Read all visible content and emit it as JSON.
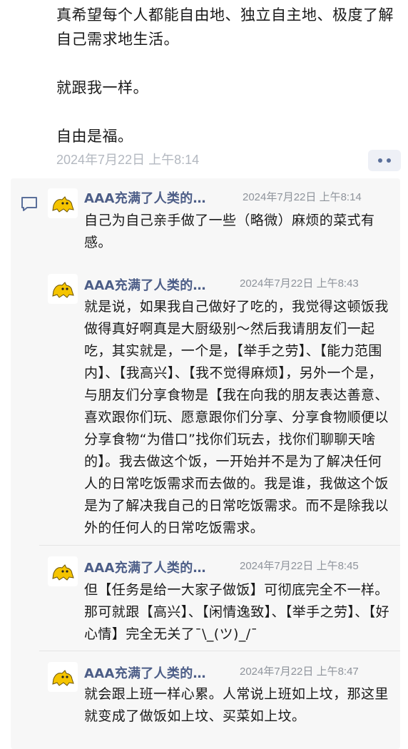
{
  "post": {
    "lines": [
      "真希望每个人都能自由地、独立自主地、极度了解自己需求地生活。",
      "就跟我一样。",
      "自由是福。"
    ],
    "timestamp": "2024年7月22日 上午8:14",
    "more_icon": "more-dots-icon"
  },
  "comments": [
    {
      "author": "AAA充满了人类的…",
      "time": "2024年7月22日 上午8:14",
      "text": "自己为自己亲手做了一些（略微）麻烦的菜式有感。",
      "avatar_icon": "cat-avatar-icon"
    },
    {
      "author": "AAA充满了人类的…",
      "time": "2024年7月22日 上午8:43",
      "text": "就是说，如果我自己做好了吃的，我觉得这顿饭我做得真好啊真是大厨级别～然后我请朋友们一起吃，其实就是，一个是，【举手之劳】、【能力范围内】、【我高兴】、【我不觉得麻烦】，另外一个是，与朋友们分享食物是【我在向我的朋友表达善意、喜欢跟你们玩、愿意跟你们分享、分享食物顺便以分享食物“为借口”找你们玩去，找你们聊聊天啥的】。我去做这个饭，一开始并不是为了解决任何人的日常吃饭需求而去做的。我是谁，我做这个饭是为了解决我自己的日常吃饭需求。而不是除我以外的任何人的日常吃饭需求。",
      "avatar_icon": "cat-avatar-icon"
    },
    {
      "author": "AAA充满了人类的…",
      "time": "2024年7月22日 上午8:45",
      "text": "但【任务是给一大家子做饭】可彻底完全不一样。那可就跟【高兴】、【闲情逸致】、【举手之劳】、【好心情】完全无关了¯\\_(ツ)_/¯",
      "avatar_icon": "cat-avatar-icon"
    },
    {
      "author": "AAA充满了人类的…",
      "time": "2024年7月22日 上午8:47",
      "text": "就会跟上班一样心累。人常说上班如上坟，那这里就变成了做饭如上坟、买菜如上坟。",
      "avatar_icon": "cat-avatar-icon"
    }
  ],
  "colors": {
    "author": "#4c5d87",
    "comment_bg": "#f7f7f7",
    "timestamp": "#8e939b"
  },
  "comment_section_icon": "comment-icon"
}
